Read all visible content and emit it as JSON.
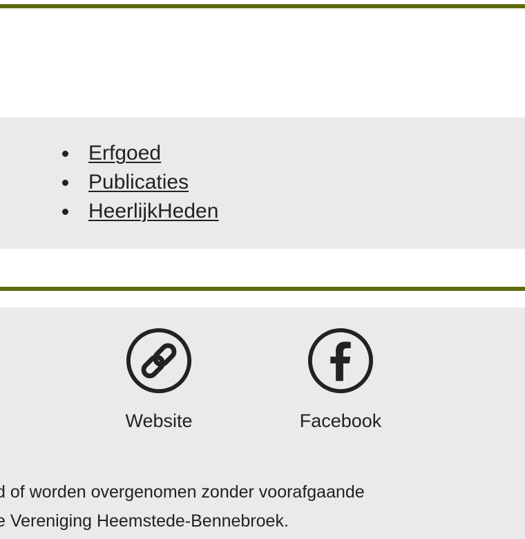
{
  "nav": {
    "items": [
      {
        "label": "Erfgoed"
      },
      {
        "label": "Publicaties"
      },
      {
        "label": "HeerlijkHeden"
      }
    ]
  },
  "footer": {
    "social": [
      {
        "label": "Website",
        "icon": "link-icon"
      },
      {
        "label": "Facebook",
        "icon": "facebook-icon"
      }
    ],
    "copyright_line1": "d of worden overgenomen zonder voorafgaande",
    "copyright_line2": "e Vereniging Heemstede-Bennebroek."
  },
  "colors": {
    "accent_rule": "#5c6b0f",
    "band_background": "#eaeaea",
    "text": "#222222"
  }
}
